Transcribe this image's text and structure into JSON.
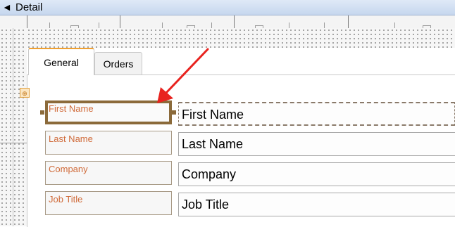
{
  "section": {
    "title": "Detail",
    "arrow_icon": "section-collapse-arrow-icon"
  },
  "tabs": [
    {
      "label": "General",
      "active": true
    },
    {
      "label": "Orders",
      "active": false
    }
  ],
  "fields": [
    {
      "label": "First Name",
      "value": "First Name",
      "selected": true
    },
    {
      "label": "Last Name",
      "value": "Last Name",
      "selected": false
    },
    {
      "label": "Company",
      "value": "Company",
      "selected": false
    },
    {
      "label": "Job Title",
      "value": "Job Title",
      "selected": false
    }
  ],
  "colors": {
    "label_text": "#d06b3a",
    "selection_border": "#8b6a3a",
    "annotation_arrow": "#e8231f",
    "active_tab_accent": "#f0a030"
  }
}
